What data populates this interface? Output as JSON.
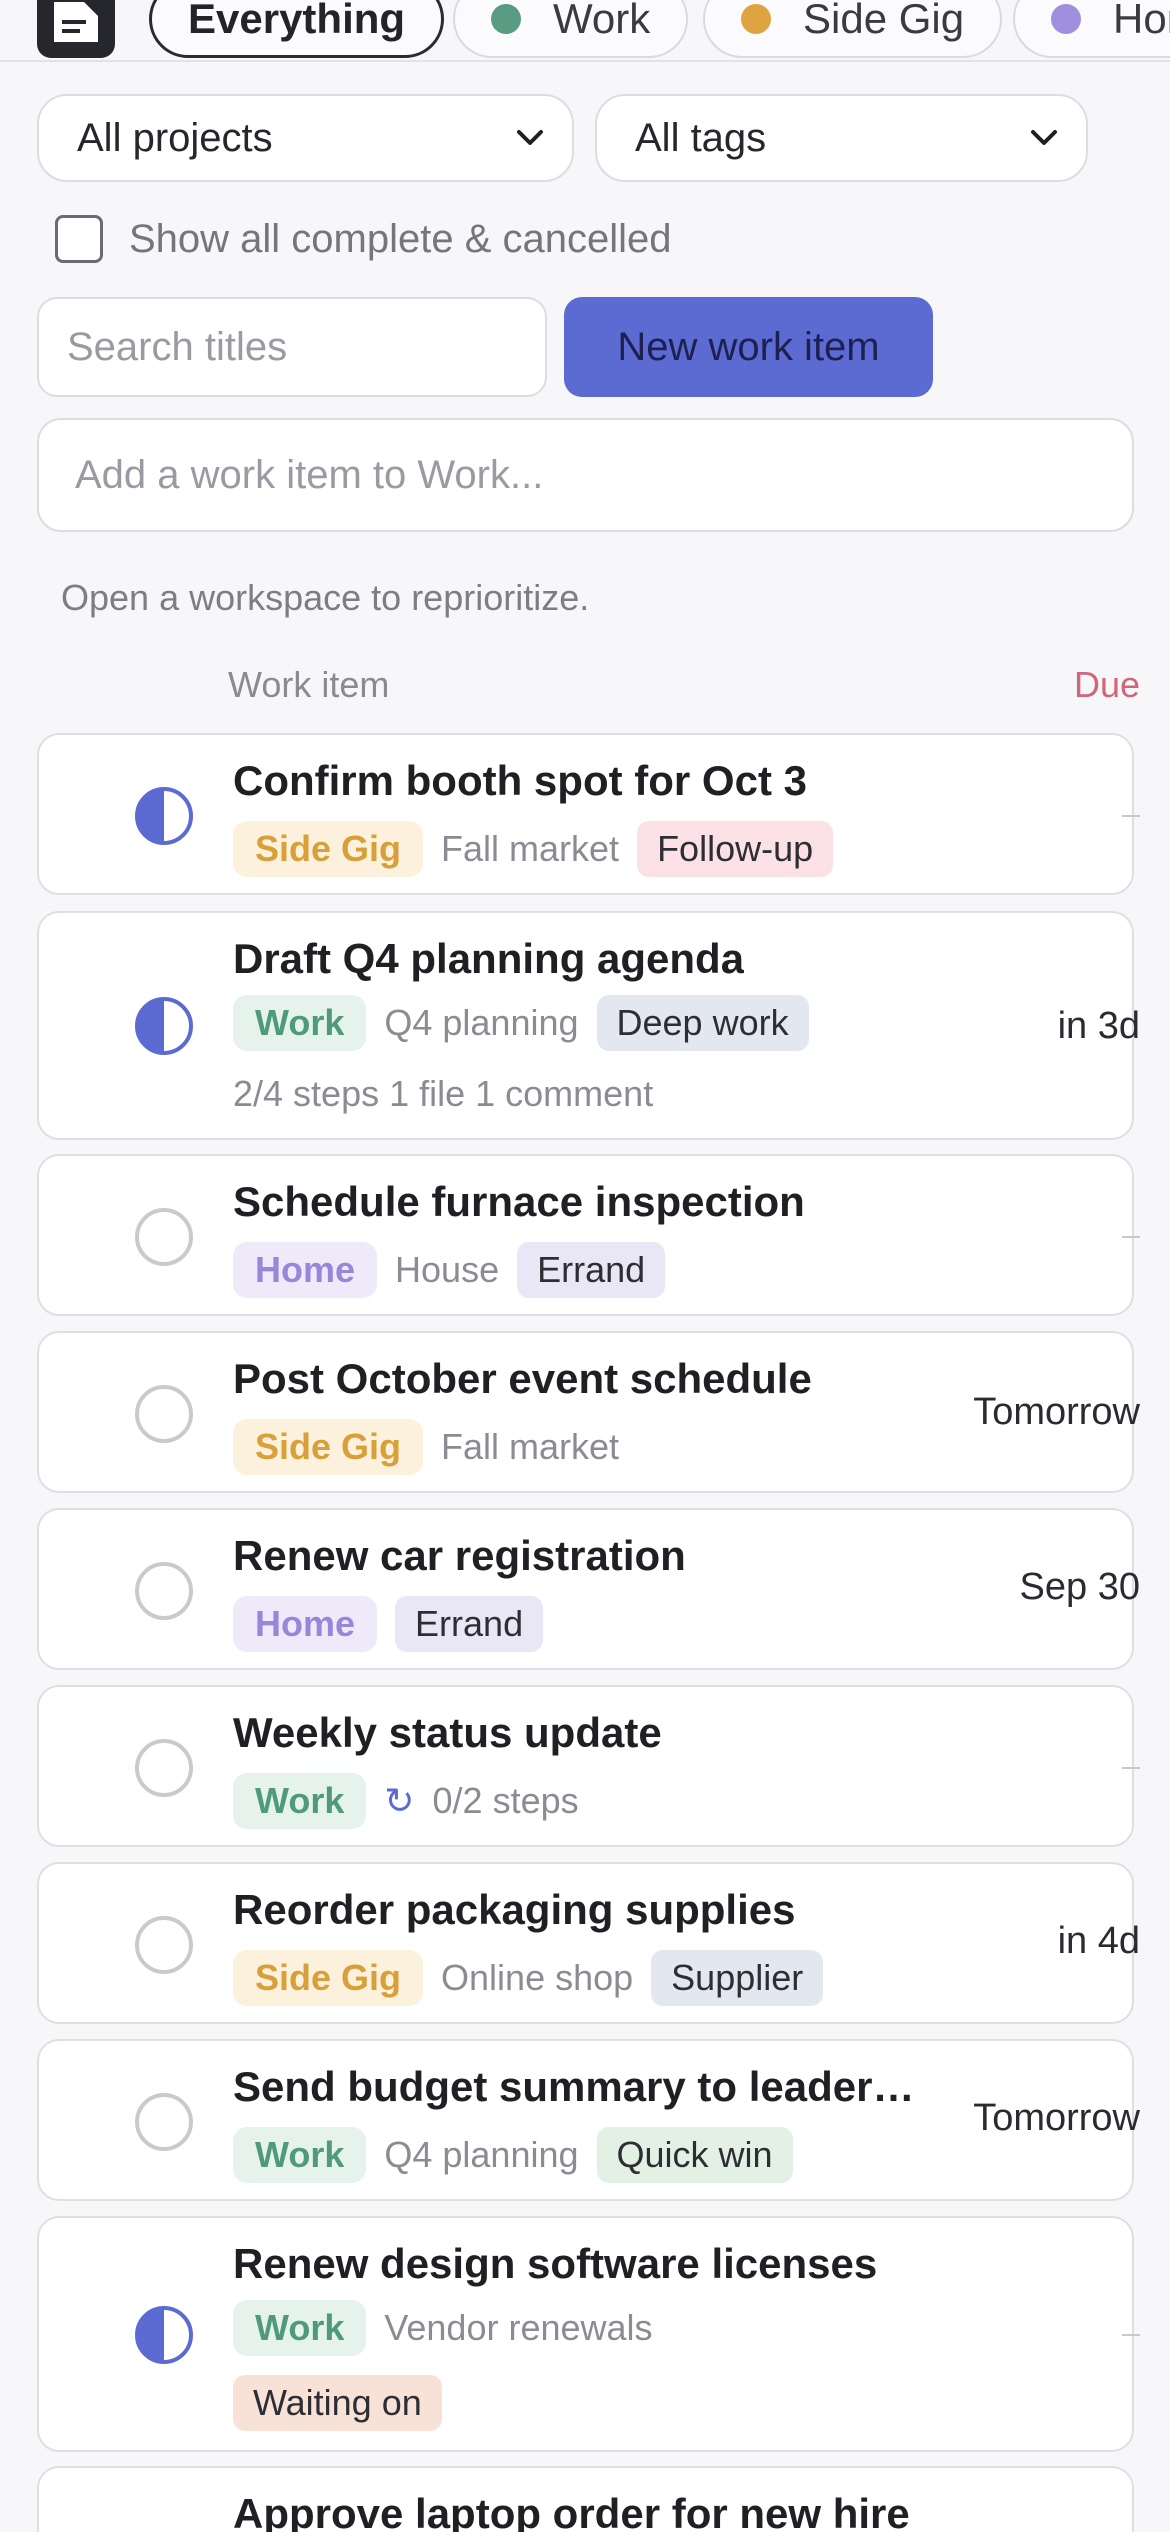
{
  "filters": {
    "chips": [
      {
        "label": "Everything",
        "active": true
      },
      {
        "label": "Work",
        "dot_color": "#5a9b83"
      },
      {
        "label": "Side Gig",
        "dot_color": "#dea43f"
      },
      {
        "label": "Home",
        "dot_color": "#a08edf"
      }
    ],
    "project_select": "All projects",
    "tag_select": "All tags",
    "show_complete_label": "Show all complete & cancelled",
    "search_placeholder": "Search titles",
    "new_button": "New work item",
    "quick_add_placeholder": "Add a work item to Work..."
  },
  "hint": "Open a workspace to reprioritize.",
  "columns": {
    "work_item": "Work item",
    "due": "Due"
  },
  "items": [
    {
      "title": "Confirm booth spot for Oct 3",
      "project": "Side Gig",
      "subproject": "Fall market",
      "tag": "Follow-up",
      "status": "in-progress",
      "due": "—"
    },
    {
      "title": "Draft Q4 planning agenda",
      "project": "Work",
      "subproject": "Q4 planning",
      "tag": "Deep work",
      "status": "in-progress",
      "steps": "2/4 steps   1 file   1 comment",
      "due": "in 3d"
    },
    {
      "title": "Schedule furnace inspection",
      "project": "Home",
      "subproject": "House",
      "tag": "Errand",
      "status": "todo",
      "due": "—"
    },
    {
      "title": "Post October event schedule",
      "project": "Side Gig",
      "subproject": "Fall market",
      "status": "todo",
      "due": "Tomorrow"
    },
    {
      "title": "Renew car registration",
      "project": "Home",
      "tag": "Errand",
      "status": "todo",
      "due": "Sep 30"
    },
    {
      "title": "Weekly status update",
      "project": "Work",
      "repeat_icon": "repeat-icon",
      "subproject": "0/2 steps",
      "status": "todo",
      "due": "—"
    },
    {
      "title": "Reorder packaging supplies",
      "project": "Side Gig",
      "subproject": "Online shop",
      "tag": "Supplier",
      "status": "todo",
      "due": "in 4d"
    },
    {
      "title": "Send budget summary to leadership",
      "project": "Work",
      "subproject": "Q4 planning",
      "tag": "Quick win",
      "status": "todo",
      "due": "Tomorrow"
    },
    {
      "title": "Renew design software licenses",
      "project": "Work",
      "subproject": "Vendor renewals",
      "tag": "Waiting on",
      "status": "in-progress",
      "due": "—"
    },
    {
      "title": "Approve laptop order for new hire"
    }
  ]
}
